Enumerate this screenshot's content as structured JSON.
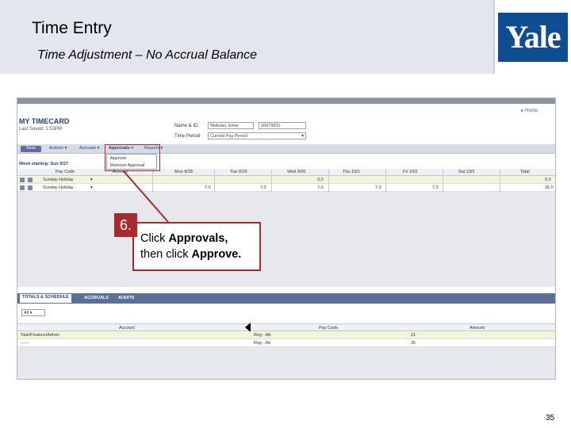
{
  "slide": {
    "title": "Time Entry",
    "subtitle": "Time Adjustment – No Accrual Balance",
    "logo_text": "Yale",
    "page_number": "35"
  },
  "timecard": {
    "home_link": "Home",
    "heading": "MY TIMECARD",
    "last_saved": "Last Saved: 1:53PM",
    "name_label": "Name & ID",
    "name_value": "Webster, Emie",
    "id_value": "20079920",
    "period_label": "Time Period",
    "period_value": "Current Pay Period",
    "toolbar": {
      "save": "Save",
      "actions": "Actions",
      "accruals": "Accruals",
      "approvals": "Approvals",
      "reports": "Reports"
    },
    "approvals_menu": [
      "Approve",
      "Remove Approval"
    ],
    "week_label": "Week starting: Sun 9/27",
    "columns": [
      "Pay Code",
      "Amount",
      "Mon 9/28",
      "Tue 9/29",
      "Wed 9/30",
      "Thu 10/1",
      "Fri 10/2",
      "Sat 10/3",
      "Total"
    ],
    "rows": [
      {
        "pay_code": "Sunday Holiday",
        "amount": "",
        "mon": "",
        "tue": "",
        "wed": "0.0",
        "thu": "",
        "fri": "",
        "sat": "",
        "total": "0.0"
      },
      {
        "pay_code": "Sunday Holiday",
        "amount": "",
        "mon": "7.0",
        "tue": "7.0",
        "wed": "7.0",
        "thu": "7.0",
        "fri": "7.0",
        "sat": "",
        "total": "35.0"
      }
    ],
    "bottom_tabs": [
      "TOTALS & SCHEDULE",
      "ACCRUALS",
      "AUDITS"
    ],
    "filter_value": "All",
    "bottom_columns": [
      "Account",
      "Pay Code",
      "Amount"
    ],
    "bottom_rows": [
      {
        "account": "Yale/Finance/Admin",
        "pay_code": "Reg - Ab",
        "amount": "21"
      },
      {
        "account": "------",
        "pay_code": "Reg - Ab",
        "amount": "35"
      }
    ]
  },
  "callout": {
    "step": "6.",
    "text_prefix": "Click ",
    "text_bold1": "Approvals,",
    "text_mid": "then click ",
    "text_bold2": "Approve.",
    "color": "#a82a2a"
  },
  "colors": {
    "header_bg": "#e3e6ef",
    "logo_blue": "#0f4d92",
    "highlight_red": "#c0202a"
  }
}
